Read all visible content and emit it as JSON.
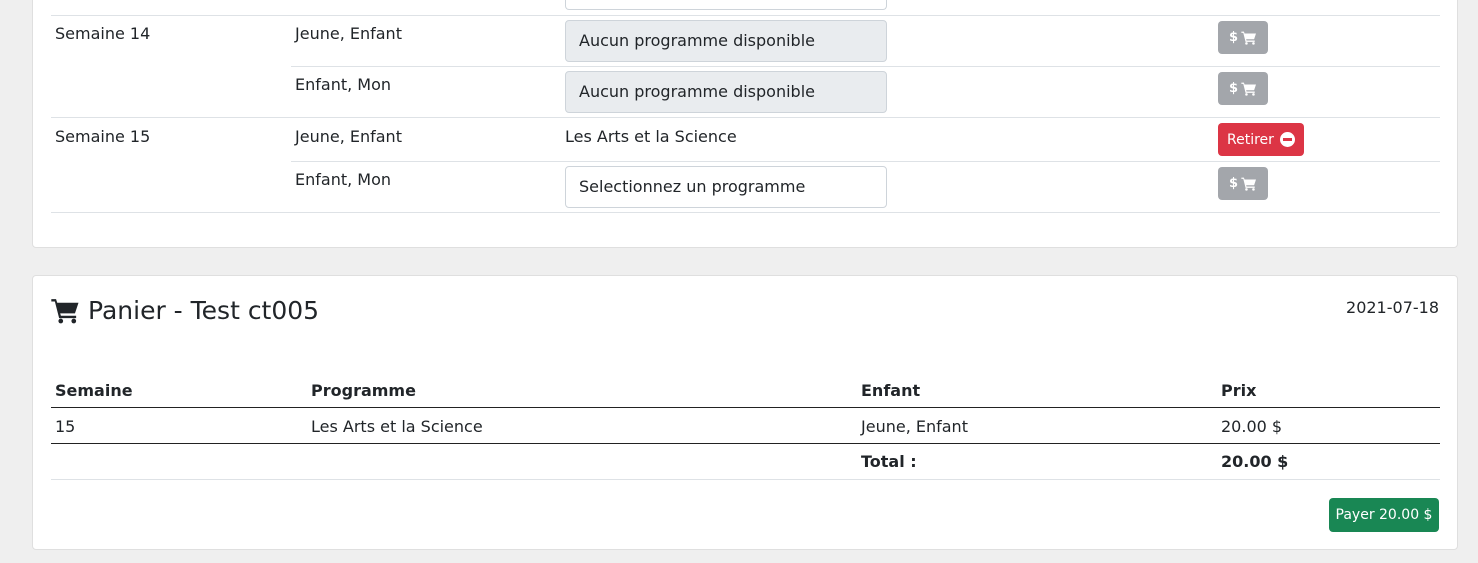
{
  "schedule": {
    "rows": [
      {
        "week": "Semaine 14",
        "children": [
          {
            "child": "Jeune, Enfant",
            "program": "Aucun programme disponible",
            "program_type": "select-disabled",
            "action": "cart"
          },
          {
            "child": "Enfant, Mon",
            "program": "Aucun programme disponible",
            "program_type": "select-disabled",
            "action": "cart"
          }
        ]
      },
      {
        "week": "Semaine 15",
        "children": [
          {
            "child": "Jeune, Enfant",
            "program": "Les Arts et la Science",
            "program_type": "text",
            "action": "remove"
          },
          {
            "child": "Enfant, Mon",
            "program": "Selectionnez un programme",
            "program_type": "select",
            "action": "cart"
          }
        ]
      }
    ],
    "cart_button_label": "$",
    "remove_button_label": "Retirer"
  },
  "cart": {
    "title": "Panier - Test ct005",
    "date": "2021-07-18",
    "columns": [
      "Semaine",
      "Programme",
      "Enfant",
      "Prix"
    ],
    "items": [
      {
        "week": "15",
        "program": "Les Arts et la Science",
        "child": "Jeune, Enfant",
        "price": "20.00 $"
      }
    ],
    "total_label": "Total :",
    "total_value": "20.00 $",
    "pay_button_label": "Payer 20.00 $"
  },
  "colors": {
    "remove": "#dc3545",
    "pay": "#198754",
    "cart_button": "#a3a6ab",
    "background": "#efefef"
  },
  "icons": [
    "shopping-cart-icon",
    "minus-circle-icon"
  ]
}
